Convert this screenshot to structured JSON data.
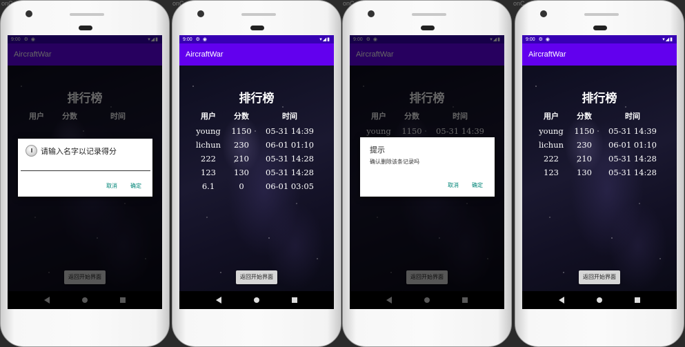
{
  "background_text": "onC",
  "status": {
    "time": "9:00"
  },
  "app": {
    "title": "AircraftWar"
  },
  "leaderboard": {
    "title": "排行榜",
    "columns": [
      "用户",
      "分数",
      "时间"
    ],
    "back_button": "返回开始界面"
  },
  "phones": [
    {
      "rows": [],
      "dialog": {
        "type": "input",
        "title": "请输入名字以记录得分",
        "cancel": "取消",
        "confirm": "确定"
      }
    },
    {
      "rows": [
        {
          "user": "young",
          "score": "1150",
          "time": "05-31 14:39"
        },
        {
          "user": "lichun",
          "score": "230",
          "time": "06-01 01:10"
        },
        {
          "user": "222",
          "score": "210",
          "time": "05-31 14:28"
        },
        {
          "user": "123",
          "score": "130",
          "time": "05-31 14:28"
        },
        {
          "user": "6.1",
          "score": "0",
          "time": "06-01 03:05"
        }
      ]
    },
    {
      "rows": [
        {
          "user": "young",
          "score": "1150",
          "time": "05-31 14:39"
        }
      ],
      "dialog": {
        "type": "confirm",
        "title": "提示",
        "message": "确认删除该条记录吗",
        "cancel": "取消",
        "confirm": "确定"
      }
    },
    {
      "rows": [
        {
          "user": "young",
          "score": "1150",
          "time": "05-31 14:39"
        },
        {
          "user": "lichun",
          "score": "230",
          "time": "06-01 01:10"
        },
        {
          "user": "222",
          "score": "210",
          "time": "05-31 14:28"
        },
        {
          "user": "123",
          "score": "130",
          "time": "05-31 14:28"
        }
      ]
    }
  ]
}
